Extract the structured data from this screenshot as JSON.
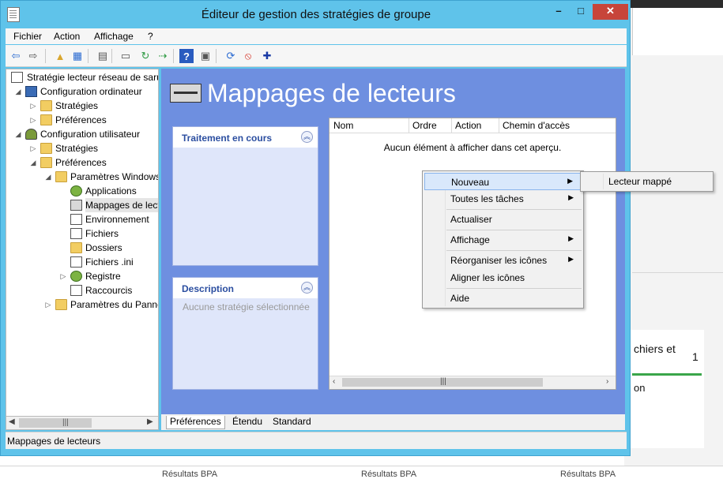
{
  "window": {
    "title": "Éditeur de gestion des stratégies de groupe",
    "controls": {
      "min": "–",
      "max": "□",
      "close": "✕"
    }
  },
  "menu": [
    "Fichier",
    "Action",
    "Affichage",
    "?"
  ],
  "toolbar": [
    {
      "name": "back-arrow-icon",
      "glyph": "⇦",
      "color": "#2a6ad1"
    },
    {
      "name": "forward-arrow-icon",
      "glyph": "⇨",
      "color": "#555555"
    },
    {
      "name": "up-folder-icon",
      "glyph": "▲",
      "color": "#d9a62e"
    },
    {
      "name": "show-hide-tree-icon",
      "glyph": "▦",
      "color": "#2a6ad1"
    },
    {
      "name": "clipboard-icon",
      "glyph": "▤",
      "color": "#555555"
    },
    {
      "name": "print-icon",
      "glyph": "▭",
      "color": "#555555"
    },
    {
      "name": "refresh-icon",
      "glyph": "↻",
      "color": "#2e9a43"
    },
    {
      "name": "export-list-icon",
      "glyph": "⇢",
      "color": "#2e9a43"
    },
    {
      "name": "help-icon",
      "glyph": "?",
      "color": "#ffffff"
    },
    {
      "name": "properties-icon",
      "glyph": "▣",
      "color": "#555555"
    },
    {
      "name": "sync-icon",
      "glyph": "⟳",
      "color": "#2a6ad1"
    },
    {
      "name": "stop-icon",
      "glyph": "⦸",
      "color": "#d4281b"
    },
    {
      "name": "add-icon",
      "glyph": "✚",
      "color": "#1a3aa5"
    }
  ],
  "tree": [
    {
      "label": "Stratégie lecteur réseau de saruj",
      "level": 0,
      "arrow": "",
      "icon": "docic",
      "name": "tree-root-policy"
    },
    {
      "label": "Configuration ordinateur",
      "level": 1,
      "arrow": "◢",
      "icon": "pcic",
      "name": "tree-computer-config"
    },
    {
      "label": "Stratégies",
      "level": 2,
      "arrow": "▷",
      "icon": "folder",
      "name": "tree-computer-policies"
    },
    {
      "label": "Préférences",
      "level": 2,
      "arrow": "▷",
      "icon": "folder",
      "name": "tree-computer-preferences"
    },
    {
      "label": "Configuration utilisateur",
      "level": 1,
      "arrow": "◢",
      "icon": "usric",
      "name": "tree-user-config"
    },
    {
      "label": "Stratégies",
      "level": 2,
      "arrow": "▷",
      "icon": "folder",
      "name": "tree-user-policies"
    },
    {
      "label": "Préférences",
      "level": 2,
      "arrow": "◢",
      "icon": "folder",
      "name": "tree-user-preferences"
    },
    {
      "label": "Paramètres Windows",
      "level": 3,
      "arrow": "◢",
      "icon": "folder",
      "name": "tree-windows-settings"
    },
    {
      "label": "Applications",
      "level": 4,
      "arrow": "",
      "icon": "gear",
      "name": "tree-applications"
    },
    {
      "label": "Mappages de lecteurs",
      "level": 4,
      "arrow": "",
      "icon": "drive",
      "name": "tree-drive-maps",
      "selected": true
    },
    {
      "label": "Environnement",
      "level": 4,
      "arrow": "",
      "icon": "docic",
      "name": "tree-environment"
    },
    {
      "label": "Fichiers",
      "level": 4,
      "arrow": "",
      "icon": "docic",
      "name": "tree-files"
    },
    {
      "label": "Dossiers",
      "level": 4,
      "arrow": "",
      "icon": "folder",
      "name": "tree-folders"
    },
    {
      "label": "Fichiers .ini",
      "level": 4,
      "arrow": "",
      "icon": "docic",
      "name": "tree-ini-files"
    },
    {
      "label": "Registre",
      "level": 4,
      "arrow": "▷",
      "icon": "gear",
      "name": "tree-registry"
    },
    {
      "label": "Raccourcis",
      "level": 4,
      "arrow": "",
      "icon": "docic",
      "name": "tree-shortcuts"
    },
    {
      "label": "Paramètres du Panneau de configuration",
      "level": 3,
      "arrow": "▷",
      "icon": "folder",
      "name": "tree-control-panel-settings"
    }
  ],
  "content": {
    "title": "Mappages de lecteurs",
    "processing": {
      "header": "Traitement en cours"
    },
    "description": {
      "header": "Description",
      "body": "Aucune stratégie sélectionnée"
    },
    "columns": [
      "Nom",
      "Ordre",
      "Action",
      "Chemin d'accès"
    ],
    "empty_text": "Aucun élément à afficher dans cet aperçu."
  },
  "context_menu": {
    "items": [
      "Nouveau",
      "Toutes les tâches",
      "Actualiser",
      "Affichage",
      "Réorganiser les icônes",
      "Aligner les icônes",
      "Aide"
    ],
    "submenu": [
      "Lecteur mappé"
    ]
  },
  "tabs": [
    "Préférences",
    "Étendu",
    "Standard"
  ],
  "status": "Mappages de lecteurs",
  "background": {
    "tile_text": "chiers et",
    "tile_number": "1",
    "tile_text2": "on",
    "bottom_labels": [
      "Résultats BPA",
      "Résultats BPA",
      "Résultats BPA"
    ]
  }
}
